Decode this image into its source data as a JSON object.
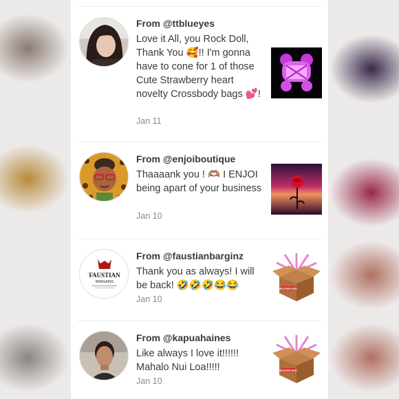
{
  "reviews": [
    {
      "from": "From @ttblueyes",
      "text": "Love it All, you Rock Doll, Thank You 🥰!! I'm gonna have to cone for 1 of those Cute Strawberry heart novelty Crossbody bags 💕!",
      "date": "Jan 11",
      "thumb_icon": "pink-bear-bag-photo"
    },
    {
      "from": "From @enjoiboutique",
      "text": "Thaaaank you ! 🫶🏽 I ENJOI being apart of your business",
      "date": "Jan 10",
      "thumb_icon": "rose-sunset-photo"
    },
    {
      "from": "From @faustianbarginz",
      "text": "Thank you as always! I will be back! 🤣🤣🤣😂😂",
      "date": "Jan 10",
      "thumb_icon": "mystery-box-photo"
    },
    {
      "from": "From @kapuahaines",
      "text": "Like always I love it!!!!!! Mahalo Nui Loa!!!!!",
      "date": "Jan 10",
      "thumb_icon": "mystery-box-photo"
    }
  ],
  "logo": {
    "line1": "FAUSTIAN",
    "line2": "BARGAINS"
  },
  "box_label": "MYSTERY BOX",
  "colors": {
    "text": "#3a3a3a",
    "date": "#8a8a8a",
    "divider": "#ececec"
  }
}
